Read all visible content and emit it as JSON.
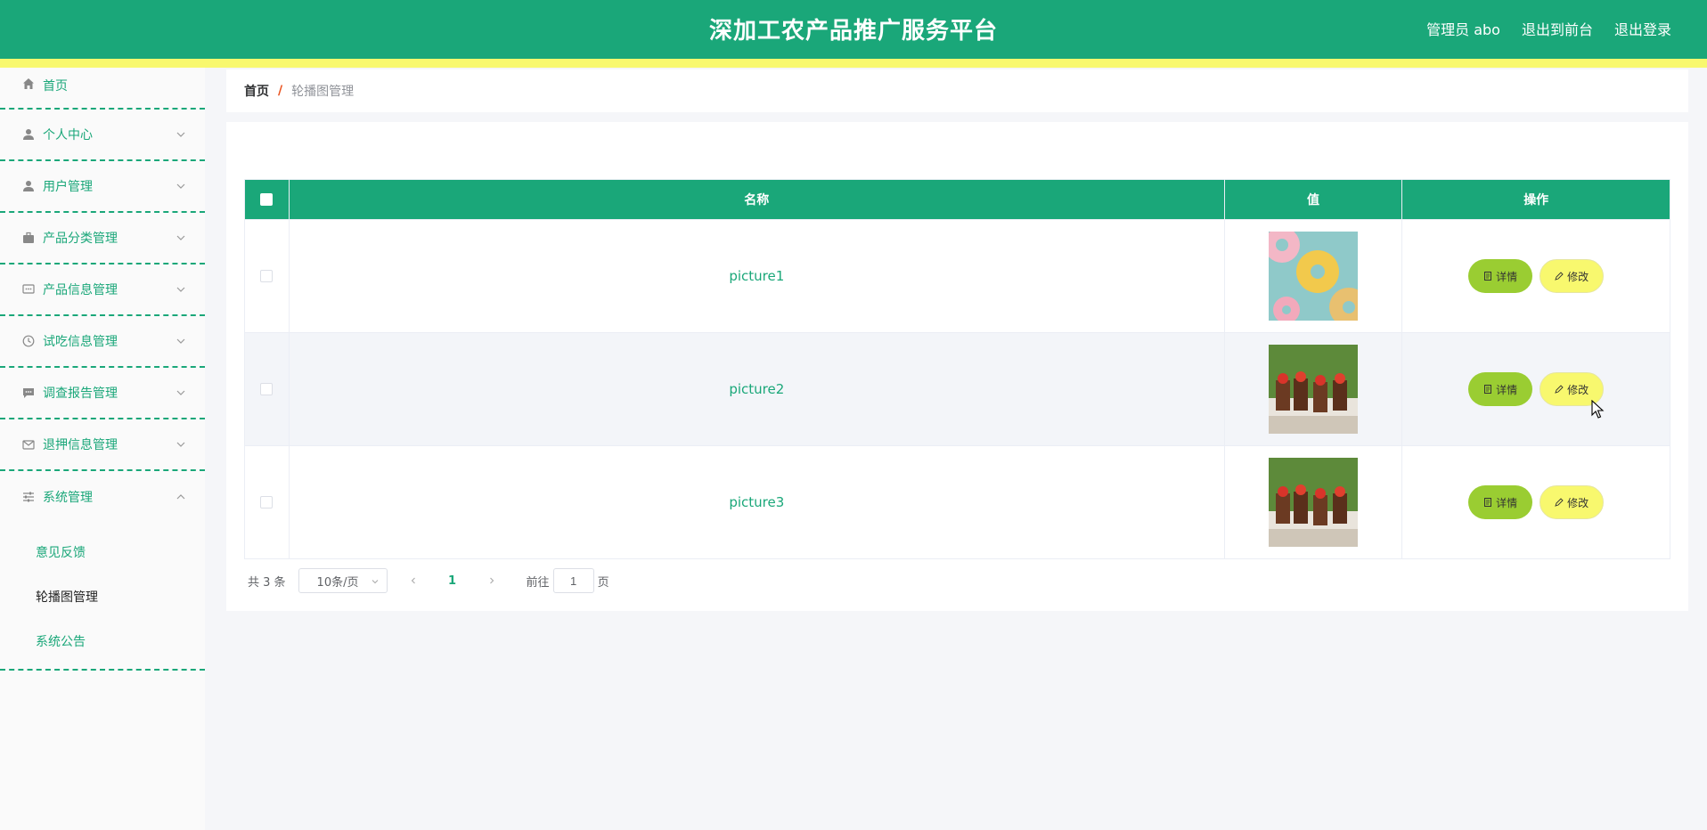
{
  "header": {
    "title": "深加工农产品推广服务平台",
    "links": [
      "管理员 abo",
      "退出到前台",
      "退出登录"
    ],
    "brand_color": "#1aa779",
    "stripe_color": "#f8f86e"
  },
  "sidebar": {
    "items": [
      {
        "label": "首页",
        "icon": "home-icon"
      },
      {
        "label": "个人中心",
        "icon": "user-icon"
      },
      {
        "label": "用户管理",
        "icon": "user-icon"
      },
      {
        "label": "产品分类管理",
        "icon": "briefcase-icon"
      },
      {
        "label": "产品信息管理",
        "icon": "message-icon"
      },
      {
        "label": "试吃信息管理",
        "icon": "clock-icon"
      },
      {
        "label": "调查报告管理",
        "icon": "chat-icon"
      },
      {
        "label": "退押信息管理",
        "icon": "mail-icon"
      },
      {
        "label": "系统管理",
        "icon": "sliders-icon"
      }
    ],
    "sub_items": [
      "意见反馈",
      "轮播图管理",
      "系统公告"
    ],
    "active_sub": "轮播图管理"
  },
  "breadcrumb": {
    "home": "首页",
    "separator": "/",
    "current": "轮播图管理"
  },
  "table": {
    "columns": [
      "名称",
      "值",
      "操作"
    ],
    "rows": [
      {
        "name": "picture1",
        "image": "donuts"
      },
      {
        "name": "picture2",
        "image": "desserts"
      },
      {
        "name": "picture3",
        "image": "desserts"
      }
    ],
    "detail_label": "详情",
    "edit_label": "修改"
  },
  "pagination": {
    "total": "共 3 条",
    "page_size": "10条/页",
    "current_page": "1",
    "goto_label": "前往",
    "goto_value": "1",
    "page_suffix": "页"
  }
}
